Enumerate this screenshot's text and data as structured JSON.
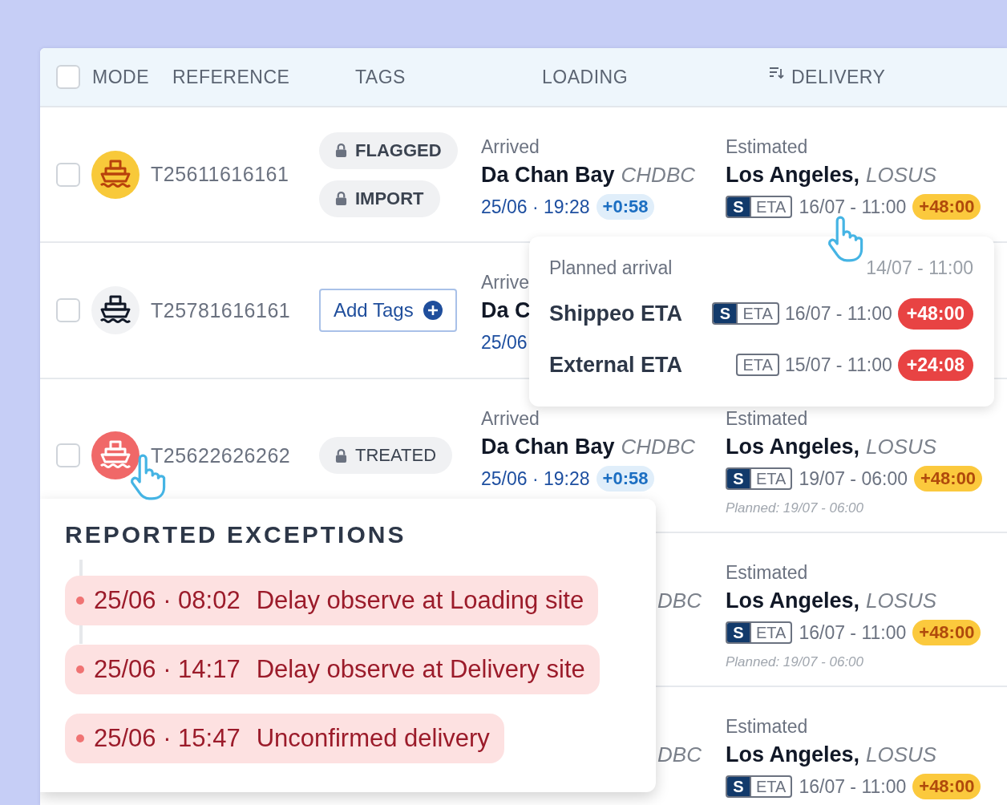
{
  "header": {
    "checkbox": {
      "checked": false
    },
    "columns": [
      "MODE",
      "REFERENCE",
      "TAGS",
      "LOADING",
      "DELIVERY"
    ]
  },
  "rows": [
    {
      "checked": false,
      "color": "#f8c93a",
      "reference": "T25611616161",
      "tags": [
        {
          "kind": "tag",
          "label": "FLAGGED",
          "bold": true
        },
        {
          "kind": "tag",
          "label": "IMPORT",
          "bold": true
        }
      ],
      "loading": {
        "status": "Arrived",
        "place": "Da Chan Bay",
        "code": "CHDBC",
        "time": "25/06 · 19:28",
        "delay": {
          "text": "+0:58",
          "color": "#e0eefa"
        }
      },
      "delivery": {
        "status": "Estimated",
        "place": "Los Angeles,",
        "code": "LOSUS",
        "eta": {
          "kind": "shippeo",
          "mark": "S",
          "label": "ETA"
        },
        "time": "16/07 - 11:00",
        "delay": {
          "text": "+48:00",
          "color": "#fbc93d"
        }
      }
    },
    {
      "checked": false,
      "color": "#f1f2f4",
      "reference": "T25781616161",
      "tags": [
        {
          "kind": "add",
          "label": "Add Tags"
        }
      ],
      "loading": {
        "status": "Arrive",
        "place": "Da C",
        "time": "25/06"
      }
    },
    {
      "checked": false,
      "color": "#f06868",
      "reference": "T25622626262",
      "tags": [
        {
          "kind": "tag",
          "label": "TREATED",
          "bold": false
        }
      ],
      "loading": {
        "status": "Arrived",
        "place": "Da Chan Bay",
        "code": "CHDBC",
        "time": "25/06 · 19:28",
        "delay": {
          "text": "+0:58",
          "color": "#e0eefa"
        }
      },
      "delivery": {
        "status": "Estimated",
        "place": "Los Angeles,",
        "code": "LOSUS",
        "eta": {
          "kind": "shippeo",
          "mark": "S",
          "label": "ETA"
        },
        "time": "19/07 - 06:00",
        "delay": {
          "text": "+48:00",
          "color": "#fbc93d"
        },
        "planned": "Planned: 19/07 - 06:00"
      }
    },
    {
      "loading": {
        "code": "DBC"
      },
      "delivery": {
        "status": "Estimated",
        "place": "Los Angeles,",
        "code": "LOSUS",
        "eta": {
          "kind": "shippeo",
          "mark": "S",
          "label": "ETA"
        },
        "time": "16/07 - 11:00",
        "delay": {
          "text": "+48:00",
          "color": "#fbc93d"
        },
        "planned": "Planned: 19/07 - 06:00"
      }
    },
    {
      "loading": {
        "code": "DBC"
      },
      "delivery": {
        "status": "Estimated",
        "place": "Los Angeles,",
        "code": "LOSUS",
        "eta": {
          "kind": "shippeo",
          "mark": "S",
          "label": "ETA"
        },
        "time": "16/07 - 11:00",
        "delay": {
          "text": "+48:00",
          "color": "#fbc93d"
        }
      }
    }
  ],
  "eta_popover": {
    "title": "Planned arrival",
    "planned": "14/07 - 11:00",
    "rows": [
      {
        "label": "Shippeo ETA",
        "eta": {
          "kind": "shippeo",
          "mark": "S",
          "label": "ETA"
        },
        "time": "16/07 - 11:00",
        "delay": {
          "text": "+48:00",
          "color": "#e84343"
        }
      },
      {
        "label": "External ETA",
        "eta": {
          "kind": "external",
          "label": "ETA"
        },
        "time": "15/07 - 11:00",
        "delay": {
          "text": "+24:08",
          "color": "#e84343"
        }
      }
    ]
  },
  "exceptions_panel": {
    "title": "REPORTED EXCEPTIONS",
    "items": [
      {
        "time": "25/06 · 08:02",
        "text": "Delay observe at Loading site"
      },
      {
        "time": "25/06 · 14:17",
        "text": "Delay observe at Delivery site"
      },
      {
        "time": "25/06 · 15:47",
        "text": "Unconfirmed delivery"
      }
    ]
  }
}
